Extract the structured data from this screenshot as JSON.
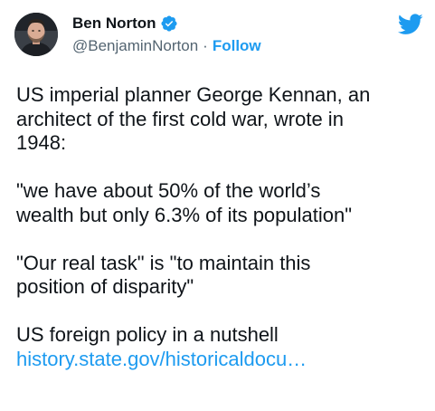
{
  "author": {
    "name": "Ben Norton",
    "handle": "@BenjaminNorton",
    "separator": "·",
    "follow_label": "Follow",
    "verified": true,
    "avatar_icon": "person-avatar-icon"
  },
  "tweet": {
    "paragraph1": [
      "US imperial planner George Kennan, an",
      "architect of the first cold war, wrote in",
      "1948:"
    ],
    "paragraph2": [
      "\"we have about 50% of the world’s",
      "wealth but only 6.3% of its population\""
    ],
    "paragraph3": [
      "\"Our real task\" is \"to maintain this",
      "position of disparity\""
    ],
    "paragraph4": [
      "US foreign policy in a nutshell"
    ],
    "link_text": "history.state.gov/historicaldocu…"
  },
  "colors": {
    "brand_blue": "#1d9bf0",
    "text": "#0f1419",
    "muted": "#536471"
  }
}
